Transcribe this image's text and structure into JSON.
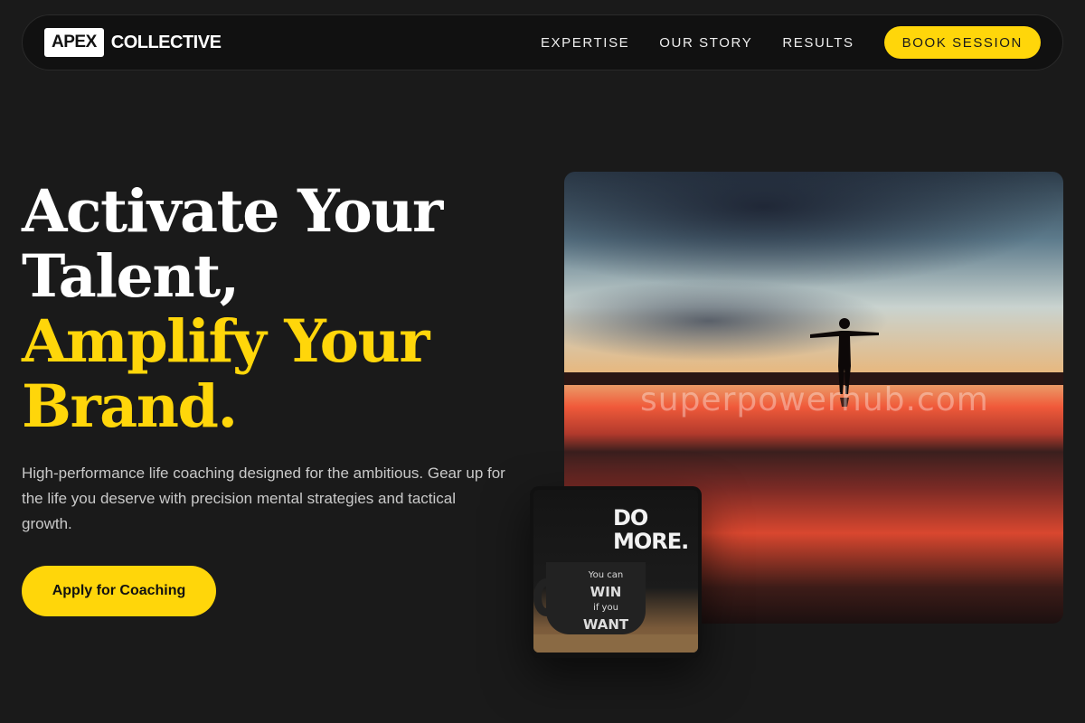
{
  "brand": {
    "box": "APEX",
    "word": "COLLECTIVE"
  },
  "nav": {
    "links": [
      "EXPERTISE",
      "OUR STORY",
      "RESULTS"
    ],
    "cta": "BOOK SESSION"
  },
  "hero": {
    "line1": "Activate Your",
    "line2": "Talent,",
    "line3": "Amplify Your",
    "line4": "Brand.",
    "subtext": "High-performance life coaching designed for the ambitious. Gear up for the life you deserve with precision mental strategies and tactical growth.",
    "apply_label": "Apply for Coaching"
  },
  "image": {
    "watermark": "superpowerhub.com"
  },
  "mug": {
    "sign": "DO MORE.",
    "line1": "You can",
    "line2": "WIN",
    "line3": "if you",
    "line4": "WANT"
  },
  "colors": {
    "accent": "#ffd60a",
    "background": "#1a1a1a"
  }
}
